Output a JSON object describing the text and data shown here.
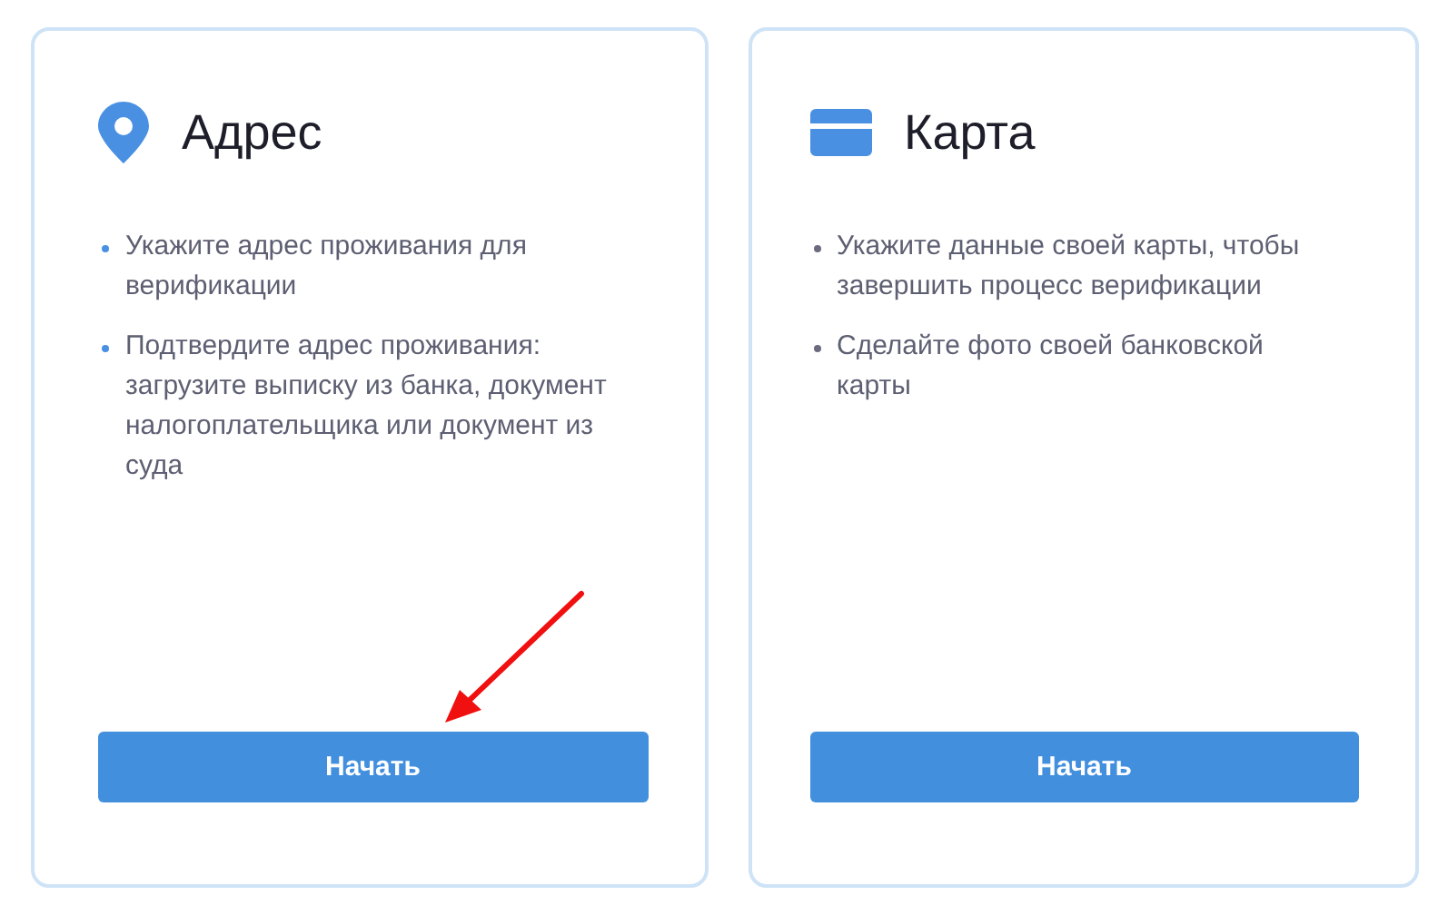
{
  "cards": [
    {
      "kind": "pin",
      "title": "Адрес",
      "color": "#4a90e2",
      "items": [
        "Укажите адрес проживания для верификации",
        "Подтвердите адрес проживания: загрузите выписку из банка, документ налогоплательщика или документ из суда"
      ],
      "button": "Начать"
    },
    {
      "kind": "card",
      "title": "Карта",
      "color": "#6b6b80",
      "items": [
        "Укажите данные своей карты, чтобы завершить процесс верификации",
        "Сделайте фото своей банковской карты"
      ],
      "button": "Начать"
    }
  ]
}
